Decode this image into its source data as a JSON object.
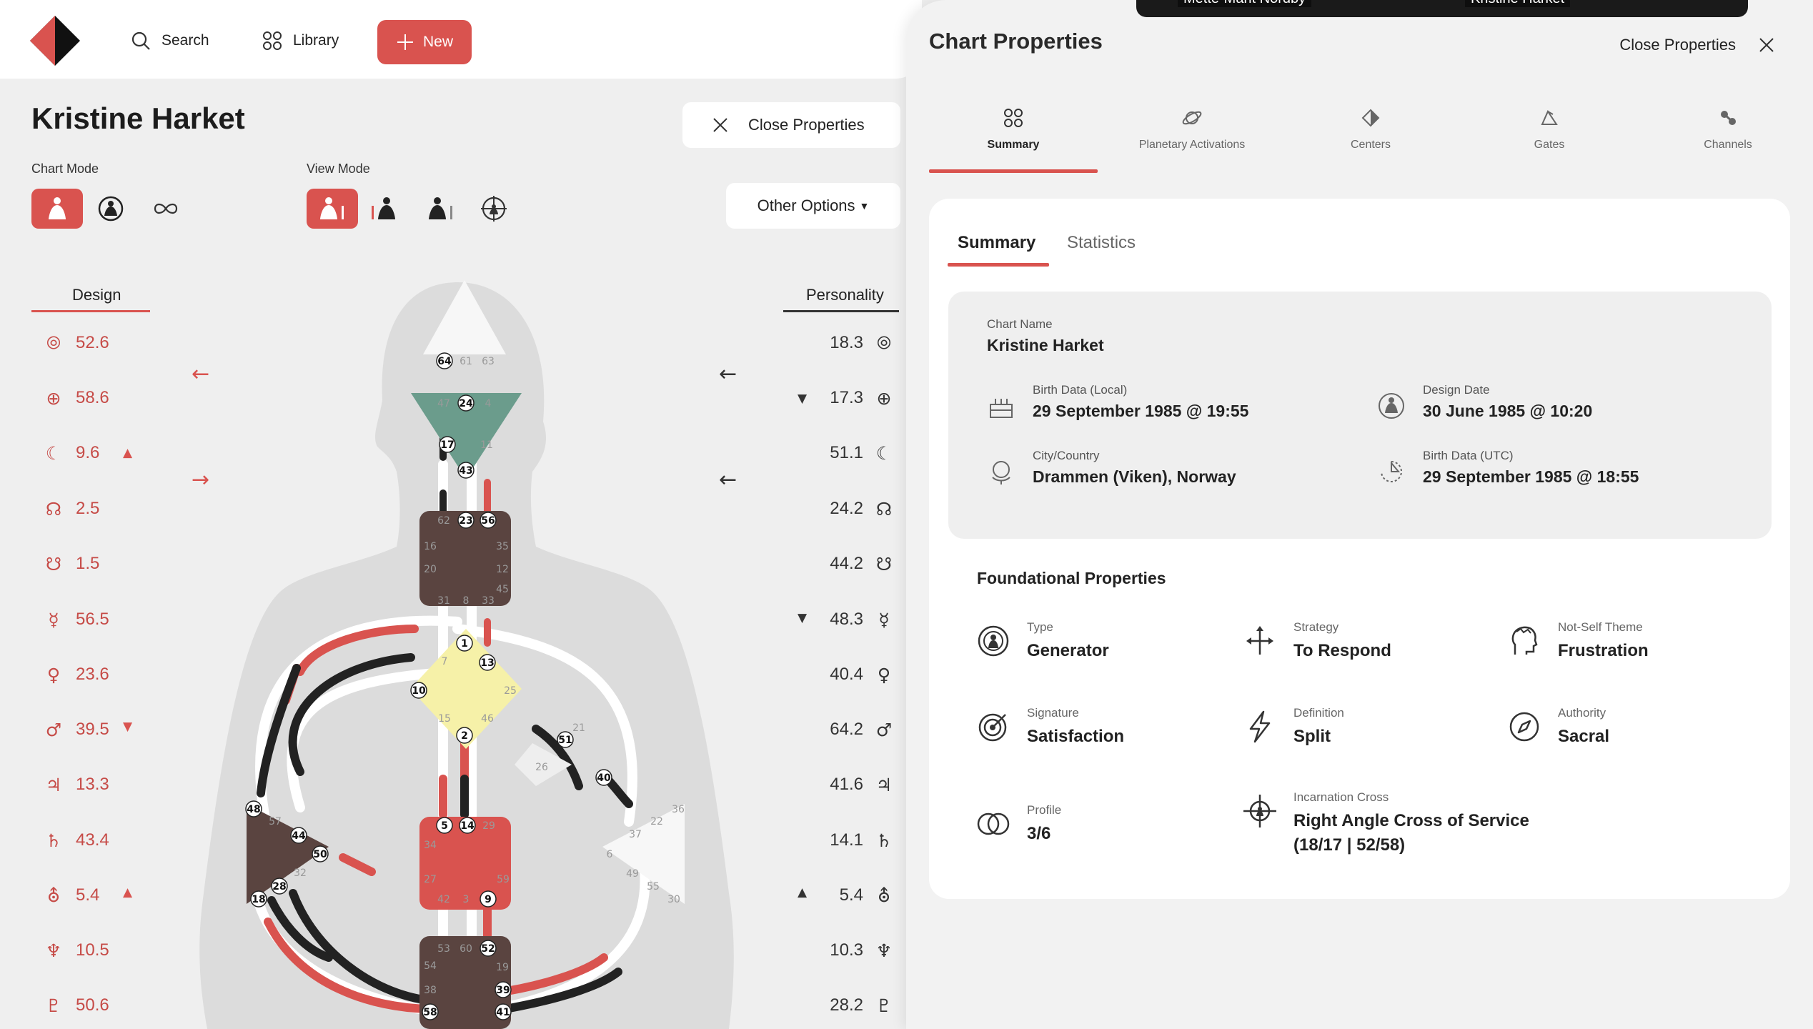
{
  "topbar": {
    "search_label": "Search",
    "library_label": "Library",
    "new_label": "New"
  },
  "chart": {
    "name": "Kristine Harket",
    "close_properties_label": "Close Properties",
    "chart_mode_label": "Chart Mode",
    "view_mode_label": "View Mode",
    "other_options_label": "Other Options"
  },
  "design": {
    "header": "Design",
    "values": [
      "52.6",
      "58.6",
      "9.6",
      "2.5",
      "1.5",
      "56.5",
      "23.6",
      "39.5",
      "13.3",
      "43.4",
      "5.4",
      "10.5",
      "50.6"
    ]
  },
  "personality": {
    "header": "Personality",
    "values": [
      "18.3",
      "17.3",
      "51.1",
      "24.2",
      "44.2",
      "48.3",
      "40.4",
      "64.2",
      "41.6",
      "14.1",
      "5.4",
      "10.3",
      "28.2"
    ]
  },
  "planet_glyphs": [
    "⦾",
    "⊕",
    "☾",
    "☊",
    "☋",
    "☿",
    "♀",
    "♂",
    "♃",
    "♄",
    "⛢",
    "♆",
    "♇"
  ],
  "gates": {
    "g64": "64",
    "g61": "61",
    "g63": "63",
    "g47": "47",
    "g24": "24",
    "g4": "4",
    "g17": "17",
    "g11": "11",
    "g43": "43",
    "g62": "62",
    "g23": "23",
    "g56": "56",
    "g16": "16",
    "g35": "35",
    "g20": "20",
    "g12": "12",
    "g45": "45",
    "g31": "31",
    "g8": "8",
    "g33": "33",
    "g1": "1",
    "g7": "7",
    "g13": "13",
    "g10": "10",
    "g25": "25",
    "g15": "15",
    "g46": "46",
    "g2": "2",
    "g21": "21",
    "g51": "51",
    "g26": "26",
    "g40": "40",
    "g48": "48",
    "g57": "57",
    "g44": "44",
    "g50": "50",
    "g32": "32",
    "g28": "28",
    "g18": "18",
    "g5": "5",
    "g14": "14",
    "g29": "29",
    "g34": "34",
    "g27": "27",
    "g59": "59",
    "g42": "42",
    "g3": "3",
    "g9": "9",
    "g36": "36",
    "g22": "22",
    "g37": "37",
    "g6": "6",
    "g49": "49",
    "g55": "55",
    "g30": "30",
    "g53": "53",
    "g60": "60",
    "g52": "52",
    "g54": "54",
    "g19": "19",
    "g38": "38",
    "g39": "39",
    "g58": "58",
    "g41": "41"
  },
  "video": {
    "participant_1": "Mette-Marit Nordby",
    "participant_2": "Kristine Harket"
  },
  "panel": {
    "title": "Chart Properties",
    "close_label": "Close Properties",
    "tabs": [
      "Summary",
      "Planetary Activations",
      "Centers",
      "Gates",
      "Channels"
    ],
    "subtabs": [
      "Summary",
      "Statistics"
    ]
  },
  "summary": {
    "chart_name_label": "Chart Name",
    "chart_name": "Kristine Harket",
    "birth_local_label": "Birth Data (Local)",
    "birth_local": "29 September 1985 @ 19:55",
    "design_date_label": "Design Date",
    "design_date": "30 June 1985 @ 10:20",
    "city_label": "City/Country",
    "city": "Drammen (Viken), Norway",
    "birth_utc_label": "Birth Data (UTC)",
    "birth_utc": "29 September 1985 @ 18:55"
  },
  "foundational": {
    "title": "Foundational Properties",
    "type_label": "Type",
    "type": "Generator",
    "strategy_label": "Strategy",
    "strategy": "To Respond",
    "notself_label": "Not-Self Theme",
    "notself": "Frustration",
    "signature_label": "Signature",
    "signature": "Satisfaction",
    "definition_label": "Definition",
    "definition": "Split",
    "authority_label": "Authority",
    "authority": "Sacral",
    "profile_label": "Profile",
    "profile": "3/6",
    "cross_label": "Incarnation Cross",
    "cross": "Right Angle Cross of Service (18/17 | 52/58)"
  },
  "colors": {
    "accent": "#d9534f",
    "defined_brown": "#5a4440",
    "head_white": "#f7f7f7",
    "ajna_green": "#6b9c8c",
    "g_yellow": "#f6f1a8"
  }
}
